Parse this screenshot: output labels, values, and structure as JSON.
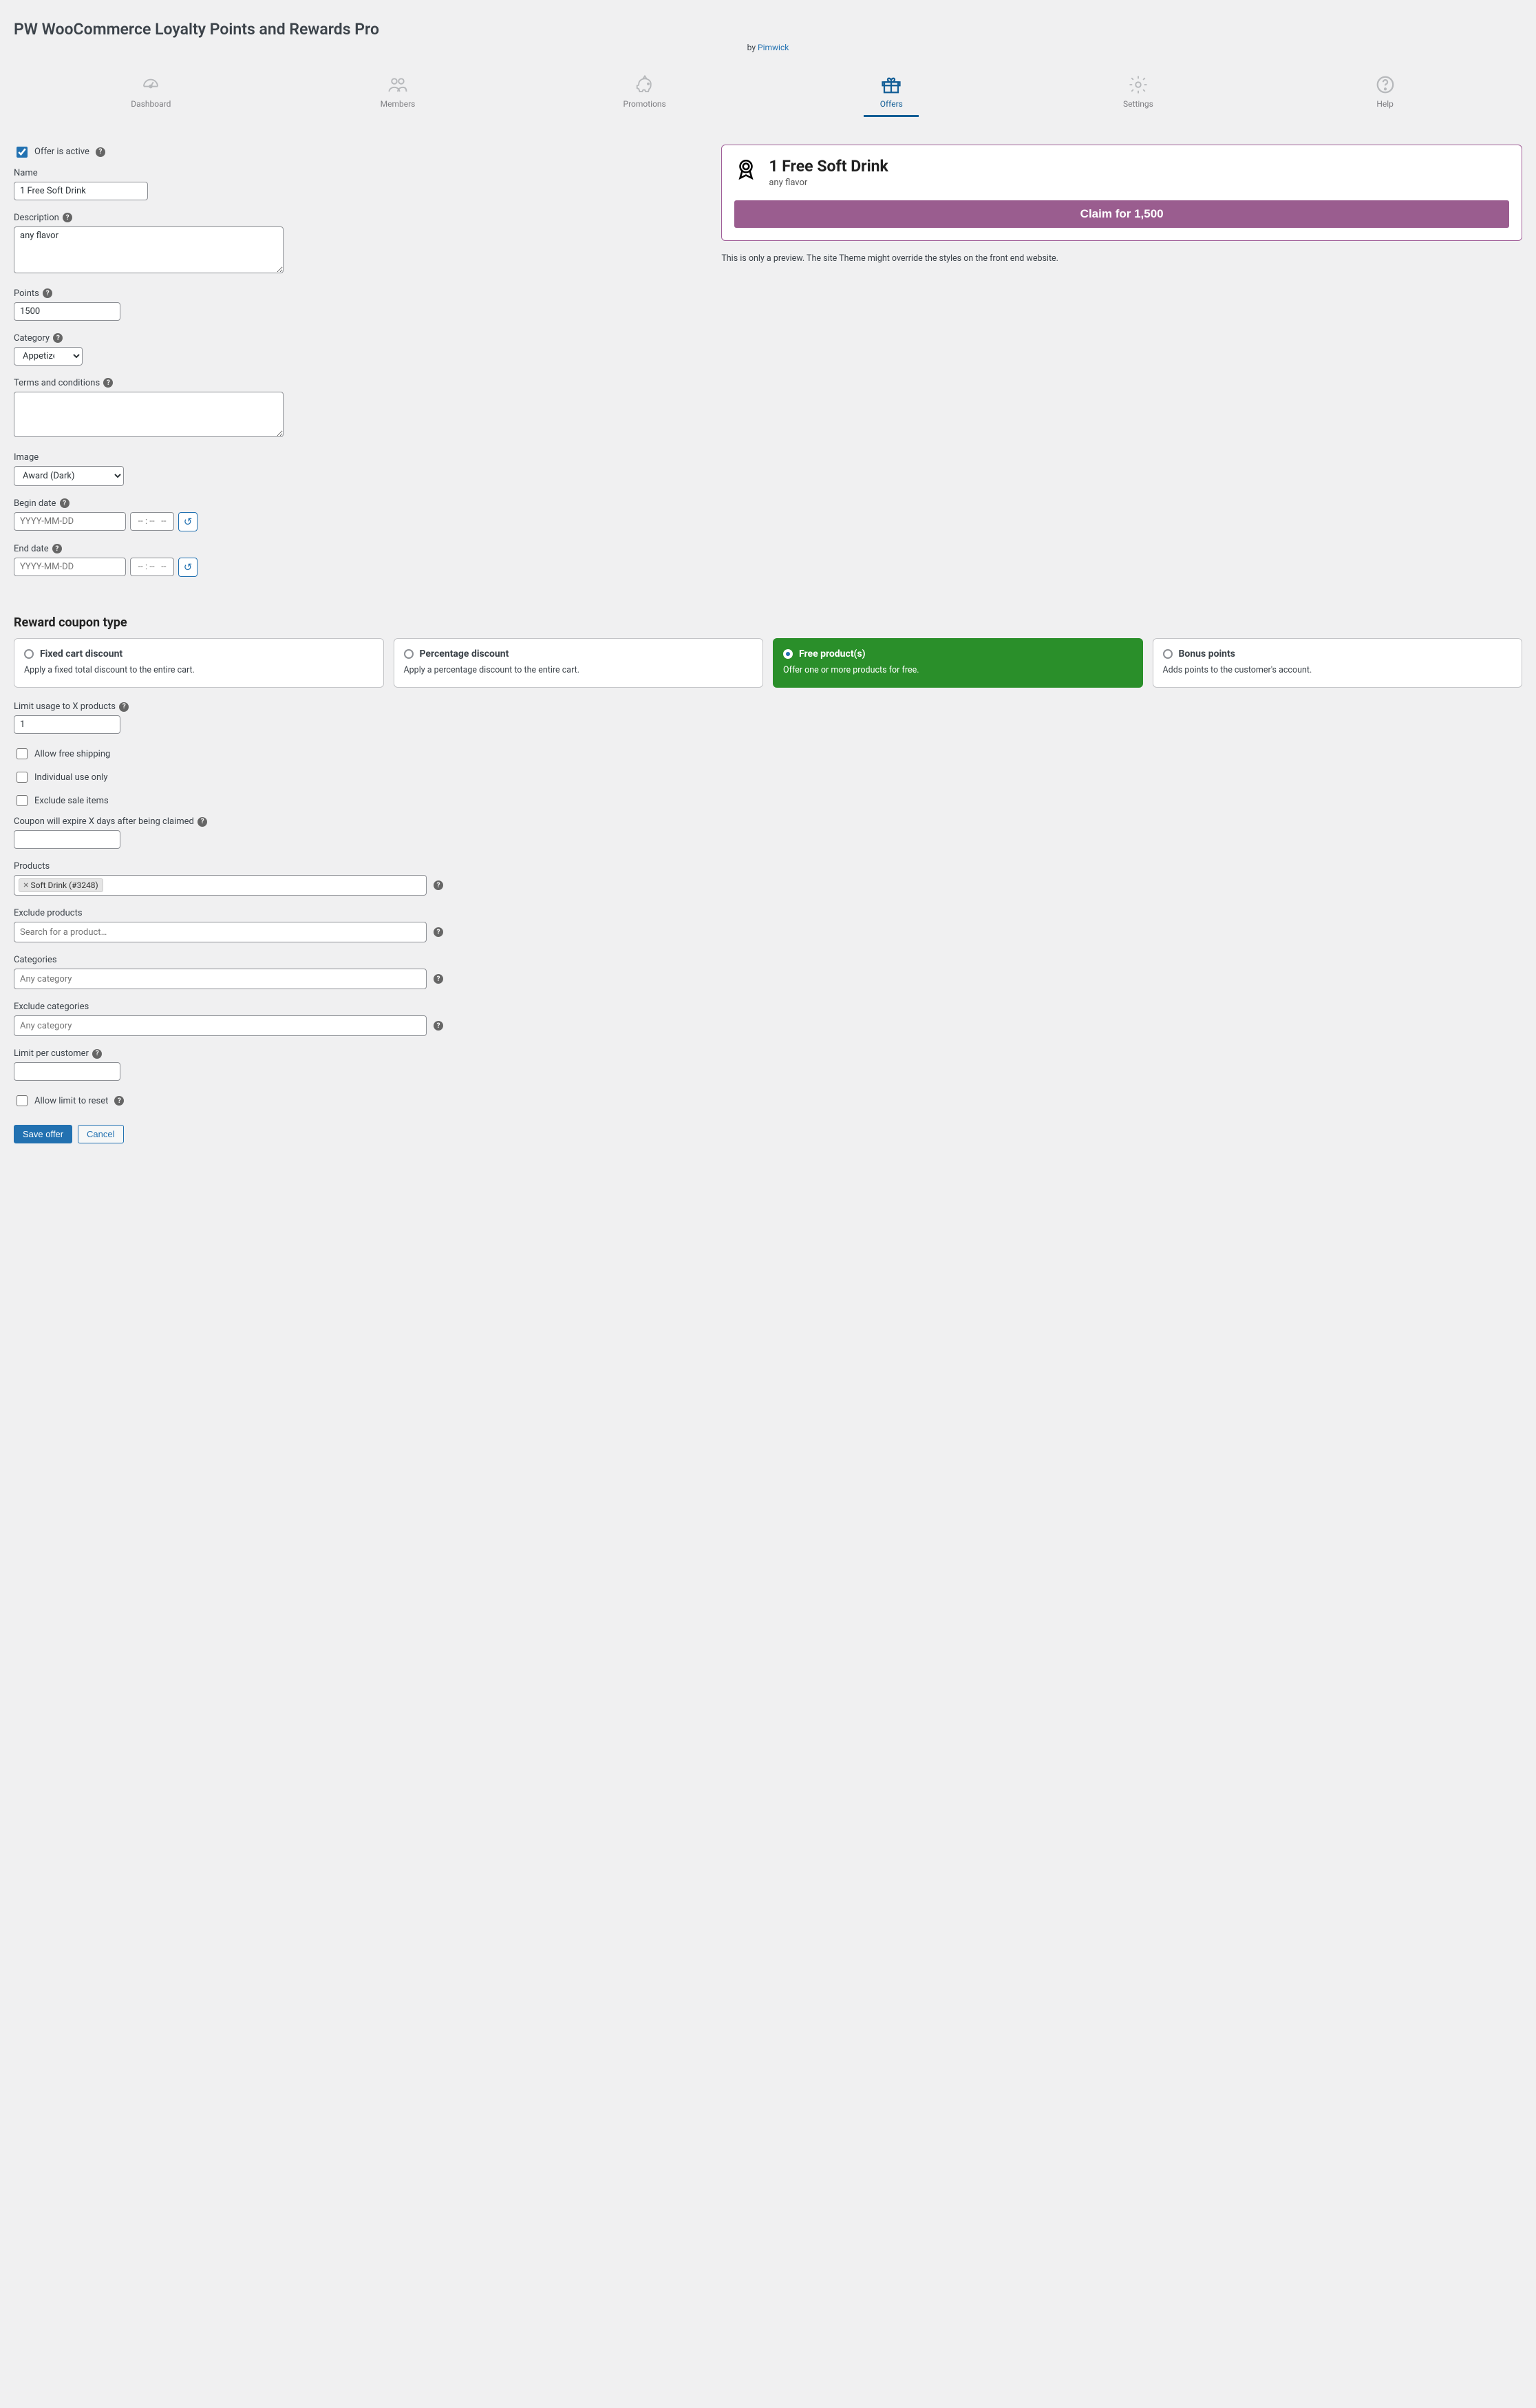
{
  "header": {
    "title": "PW WooCommerce Loyalty Points and Rewards Pro",
    "by": "by",
    "company": "Pimwick"
  },
  "tabs": [
    {
      "label": "Dashboard"
    },
    {
      "label": "Members"
    },
    {
      "label": "Promotions"
    },
    {
      "label": "Offers",
      "active": true
    },
    {
      "label": "Settings"
    },
    {
      "label": "Help"
    }
  ],
  "form": {
    "active_checkbox_label": "Offer is active",
    "name_label": "Name",
    "name_value": "1 Free Soft Drink",
    "description_label": "Description",
    "description_value": "any flavor",
    "points_label": "Points",
    "points_value": "1500",
    "category_label": "Category",
    "category_value": "Appetizers",
    "tc_label": "Terms and conditions",
    "tc_value": "",
    "image_label": "Image",
    "image_value": "Award (Dark)",
    "begin_label": "Begin date",
    "end_label": "End date",
    "date_placeholder": "YYYY-MM-DD",
    "time_placeholder": "-- : --   --"
  },
  "preview": {
    "title": "1 Free Soft Drink",
    "subtitle": "any flavor",
    "claim": "Claim for 1,500",
    "note": "This is only a preview. The site Theme might override the styles on the front end website."
  },
  "coupon": {
    "section_title": "Reward coupon type",
    "types": [
      {
        "title": "Fixed cart discount",
        "desc": "Apply a fixed total discount to the entire cart."
      },
      {
        "title": "Percentage discount",
        "desc": "Apply a percentage discount to the entire cart."
      },
      {
        "title": "Free product(s)",
        "desc": "Offer one or more products for free.",
        "selected": true
      },
      {
        "title": "Bonus points",
        "desc": "Adds points to the customer's account."
      }
    ],
    "limit_usage_label": "Limit usage to X products",
    "limit_usage_value": "1",
    "free_shipping_label": "Allow free shipping",
    "individual_use_label": "Individual use only",
    "exclude_sale_label": "Exclude sale items",
    "expire_label": "Coupon will expire X days after being claimed",
    "expire_value": "",
    "products_label": "Products",
    "products_chip": "Soft Drink (#3248)",
    "exclude_products_label": "Exclude products",
    "exclude_products_placeholder": "Search for a product…",
    "categories_label": "Categories",
    "categories_placeholder": "Any category",
    "exclude_categories_label": "Exclude categories",
    "exclude_categories_placeholder": "Any category",
    "limit_per_customer_label": "Limit per customer",
    "limit_per_customer_value": "",
    "allow_reset_label": "Allow limit to reset"
  },
  "buttons": {
    "save": "Save offer",
    "cancel": "Cancel"
  }
}
